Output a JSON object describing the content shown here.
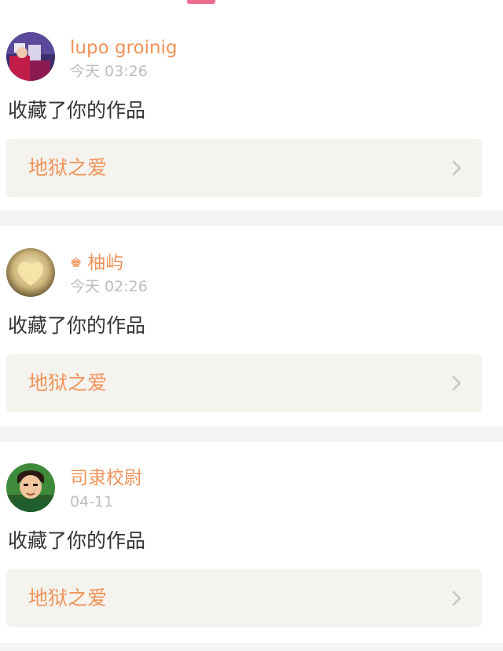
{
  "colors": {
    "accent": "#f0935a",
    "tab_indicator": "#ec6b8f",
    "card_link_bg": "#f4f3ee",
    "separator": "#f4f4f4",
    "time_text": "#bdbdbd",
    "body_text": "#333333"
  },
  "notifications": [
    {
      "user": "lupo groinig",
      "badge_icon": "",
      "time": "今天 03:26",
      "action": "收藏了你的作品",
      "work_title": "地狱之爱"
    },
    {
      "user": "柚屿",
      "badge_icon": "♚",
      "time": "今天 02:26",
      "action": "收藏了你的作品",
      "work_title": "地狱之爱"
    },
    {
      "user": "司隶校尉",
      "badge_icon": "",
      "time": "04-11",
      "action": "收藏了你的作品",
      "work_title": "地狱之爱"
    }
  ]
}
